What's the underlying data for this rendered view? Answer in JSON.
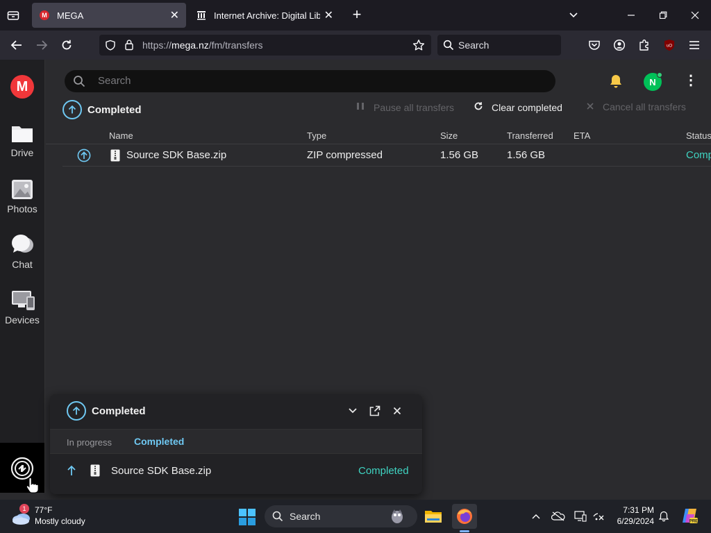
{
  "browser": {
    "tabs": [
      {
        "title": "MEGA",
        "active": true
      },
      {
        "title": "Internet Archive: Digital Library",
        "active": false
      }
    ],
    "url_prefix": "https://",
    "url_host": "mega.nz",
    "url_path": "/fm/transfers",
    "search_placeholder": "Search"
  },
  "sidebar": {
    "logo": "M",
    "items": [
      {
        "label": "Drive",
        "icon": "folder-icon"
      },
      {
        "label": "Photos",
        "icon": "photos-icon"
      },
      {
        "label": "Chat",
        "icon": "chat-icon"
      },
      {
        "label": "Devices",
        "icon": "devices-icon"
      }
    ]
  },
  "header": {
    "search_placeholder": "Search",
    "avatar_initial": "N"
  },
  "transfers": {
    "section_title": "Completed",
    "actions": {
      "pause_all": "Pause all transfers",
      "clear_completed": "Clear completed",
      "cancel_all": "Cancel all transfers"
    },
    "columns": [
      "Name",
      "Type",
      "Size",
      "Transferred",
      "ETA",
      "Status"
    ],
    "rows": [
      {
        "name": "Source SDK Base.zip",
        "type": "ZIP compressed",
        "size": "1.56 GB",
        "transferred": "1.56 GB",
        "eta": "",
        "status": "Comp"
      }
    ]
  },
  "popup": {
    "title": "Completed",
    "tabs": {
      "in_progress": "In progress",
      "completed": "Completed"
    },
    "item": {
      "name": "Source SDK Base.zip",
      "status": "Completed"
    }
  },
  "taskbar": {
    "weather_badge": "1",
    "temperature": "77°F",
    "condition": "Mostly cloudy",
    "search_placeholder": "Search",
    "time": "7:31 PM",
    "date": "6/29/2024"
  },
  "colors": {
    "accent": "#6fc8f2",
    "status_completed": "#3fd4c2",
    "mega_red": "#f0373a"
  }
}
